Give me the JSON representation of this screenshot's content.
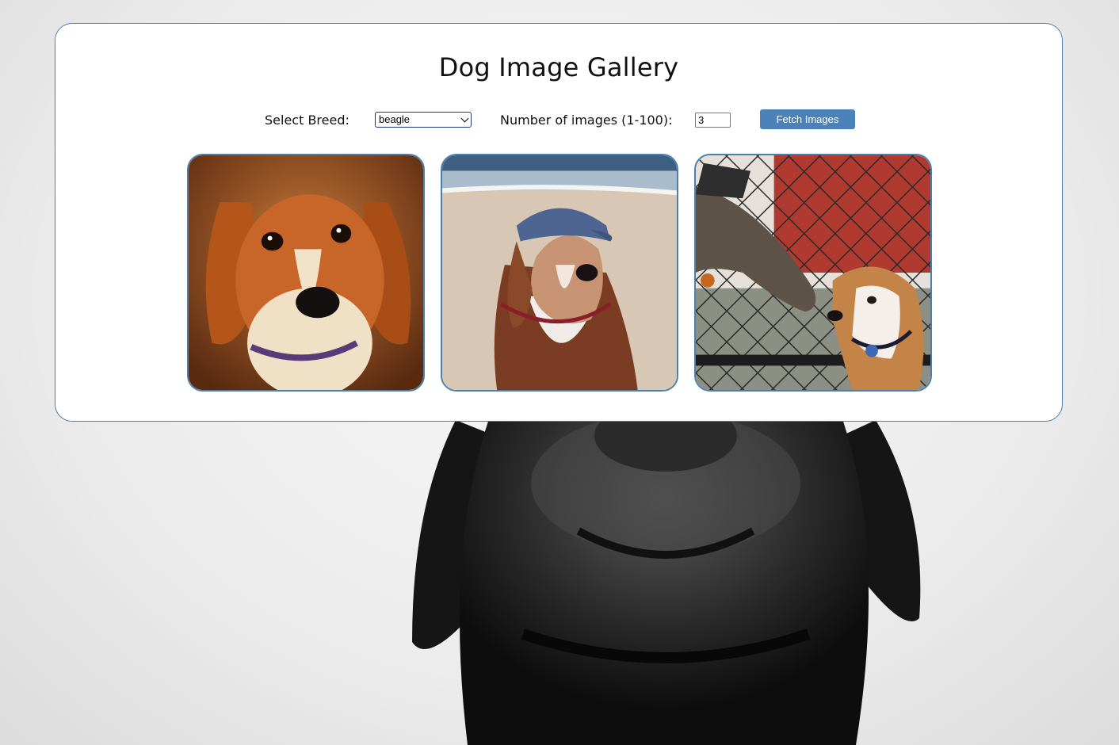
{
  "page": {
    "title": "Dog Image Gallery"
  },
  "controls": {
    "breed_label": "Select Breed:",
    "breed_selected": "beagle",
    "count_label": "Number of images (1-100):",
    "count_value": "3",
    "fetch_label": "Fetch Images"
  },
  "gallery": {
    "images": [
      {
        "subject": "beagle-portrait"
      },
      {
        "subject": "beagle-on-beach-with-cap"
      },
      {
        "subject": "beagle-and-greyhound-at-fence"
      }
    ]
  },
  "colors": {
    "accent": "#4b82b8",
    "card_border": "#4a7fb0",
    "background": "#ececec"
  },
  "icons": {
    "select_chevron": "chevron-down-icon"
  }
}
